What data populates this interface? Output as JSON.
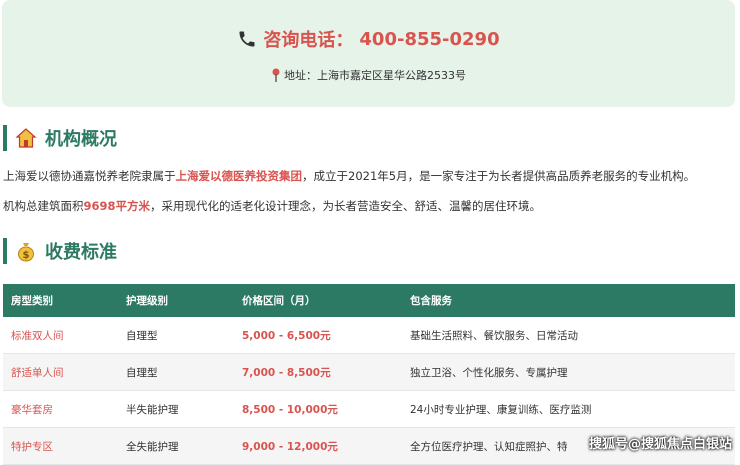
{
  "contact": {
    "phone_label": "咨询电话：",
    "phone_number": "400-855-0290",
    "address": "地址：上海市嘉定区星华公路2533号"
  },
  "overview": {
    "heading": "机构概况",
    "para1_prefix": "上海爱以德协通嘉悦养老院隶属于",
    "para1_group": "上海爱以德医养投资集团",
    "para1_suffix": "，成立于2021年5月，是一家专注于为长者提供高品质养老服务的专业机构。",
    "para2_prefix": "机构总建筑面积",
    "para2_area": "9698平方米",
    "para2_suffix": "，采用现代化的适老化设计理念，为长者营造安全、舒适、温馨的居住环境。"
  },
  "fees": {
    "heading": "收费标准",
    "columns": [
      "房型类别",
      "护理级别",
      "价格区间（月）",
      "包含服务"
    ],
    "rows": [
      {
        "type": "标准双人间",
        "care": "自理型",
        "price": "5,000 - 6,500元",
        "services": "基础生活照料、餐饮服务、日常活动"
      },
      {
        "type": "舒适单人间",
        "care": "自理型",
        "price": "7,000 - 8,500元",
        "services": "独立卫浴、个性化服务、专属护理"
      },
      {
        "type": "豪华套房",
        "care": "半失能护理",
        "price": "8,500 - 10,000元",
        "services": "24小时专业护理、康复训练、医疗监测"
      },
      {
        "type": "特护专区",
        "care": "全失能护理",
        "price": "9,000 - 12,000元",
        "services": "全方位医疗护理、认知症照护、特"
      }
    ]
  },
  "watermark": "搜狐号@搜狐焦点白银站",
  "colors": {
    "accent": "#2d7a64",
    "highlight": "#d9534f",
    "contact_bg": "#e6f3e9"
  }
}
